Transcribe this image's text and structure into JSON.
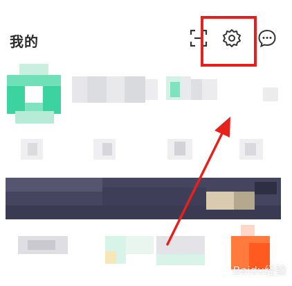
{
  "header": {
    "title": "我的",
    "icons": [
      "scan-icon",
      "settings-gear-icon",
      "message-icon"
    ]
  },
  "annotation": {
    "highlight_color": "#e8201b",
    "arrow_color": "#e8201b"
  },
  "watermark": {
    "text": "Baidu经验"
  },
  "colors": {
    "accent_green": "#3dd3a0",
    "banner_dark": "#3a3a55"
  }
}
